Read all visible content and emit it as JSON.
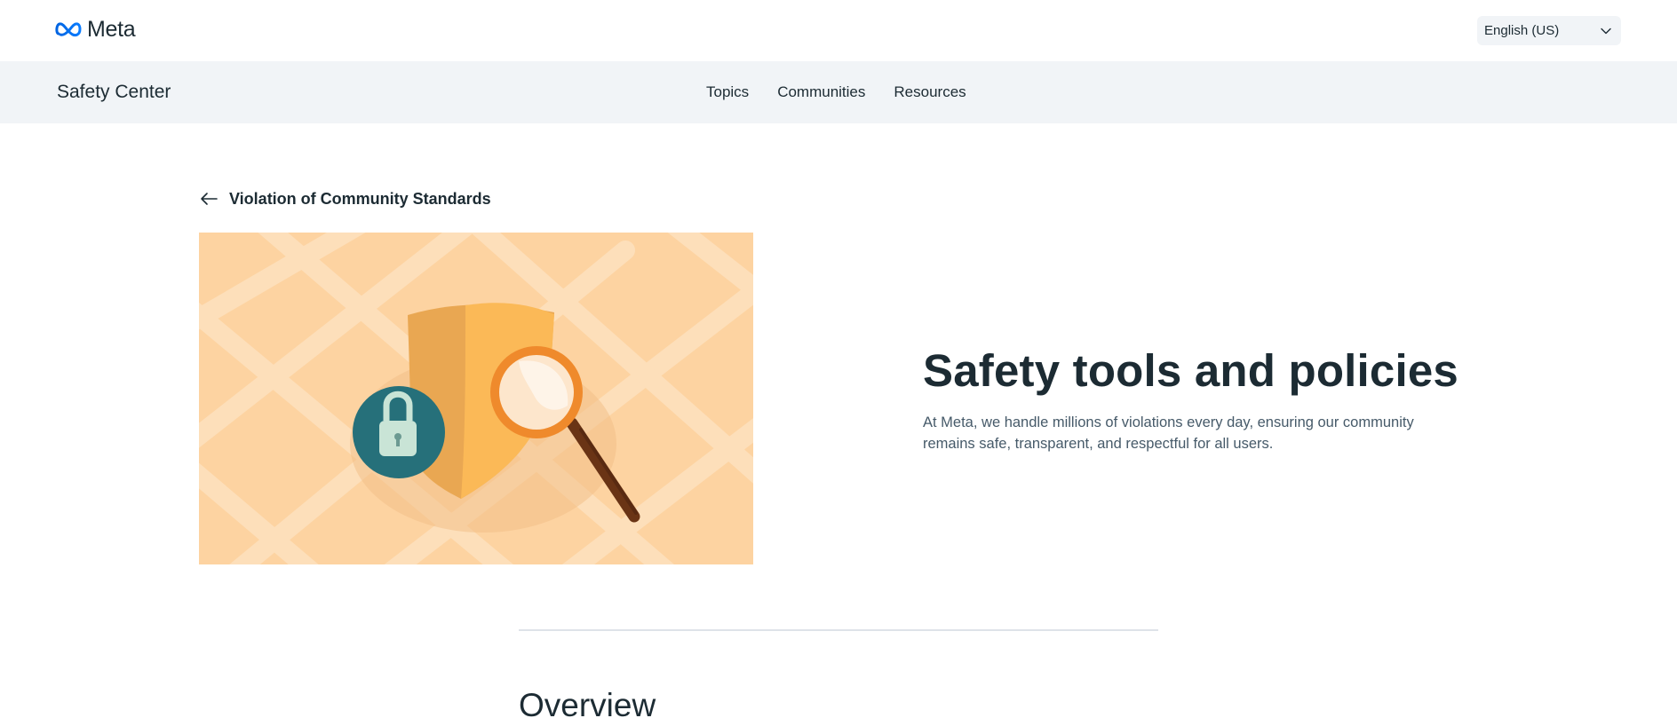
{
  "header": {
    "logo_text": "Meta",
    "language": {
      "selected": "English (US)"
    }
  },
  "subnav": {
    "site_title": "Safety Center",
    "links": [
      {
        "label": "Topics"
      },
      {
        "label": "Communities"
      },
      {
        "label": "Resources"
      }
    ]
  },
  "breadcrumb": {
    "back_label": "Violation of Community Standards"
  },
  "hero": {
    "title": "Safety tools and policies",
    "description": "At Meta, we handle millions of violations every day, ensuring our community remains safe, transparent, and respectful for all users."
  },
  "sections": {
    "overview_heading": "Overview"
  },
  "colors": {
    "meta_blue": "#0668e1",
    "text_primary": "#1c2b33",
    "text_secondary": "#465a69",
    "subnav_bg": "#f1f4f7",
    "illustration_bg": "#fdd3a1"
  },
  "icons": {
    "back": "arrow-left-icon",
    "language_dropdown": "chevron-down-icon",
    "logo": "meta-infinity-logo"
  }
}
